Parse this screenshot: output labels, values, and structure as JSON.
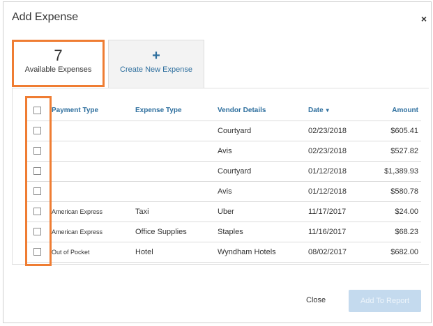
{
  "dialog": {
    "title": "Add Expense",
    "close_glyph": "×"
  },
  "tabs": {
    "available": {
      "count": "7",
      "label": "Available Expenses"
    },
    "create": {
      "plus": "+",
      "label": "Create New Expense"
    }
  },
  "table": {
    "headers": {
      "payment_type": "Payment Type",
      "expense_type": "Expense Type",
      "vendor_details": "Vendor Details",
      "date": "Date",
      "date_sort_glyph": "▼",
      "amount": "Amount"
    },
    "rows": [
      {
        "payment_type": "",
        "expense_type": "",
        "vendor": "Courtyard",
        "date": "02/23/2018",
        "amount": "$605.41"
      },
      {
        "payment_type": "",
        "expense_type": "",
        "vendor": "Avis",
        "date": "02/23/2018",
        "amount": "$527.82"
      },
      {
        "payment_type": "",
        "expense_type": "",
        "vendor": "Courtyard",
        "date": "01/12/2018",
        "amount": "$1,389.93"
      },
      {
        "payment_type": "",
        "expense_type": "",
        "vendor": "Avis",
        "date": "01/12/2018",
        "amount": "$580.78"
      },
      {
        "payment_type": "American Express",
        "expense_type": "Taxi",
        "vendor": "Uber",
        "date": "11/17/2017",
        "amount": "$24.00"
      },
      {
        "payment_type": "American Express",
        "expense_type": "Office Supplies",
        "vendor": "Staples",
        "date": "11/16/2017",
        "amount": "$68.23"
      },
      {
        "payment_type": "Out of Pocket",
        "expense_type": "Hotel",
        "vendor": "Wyndham Hotels",
        "date": "08/02/2017",
        "amount": "$682.00"
      }
    ]
  },
  "footer": {
    "close_label": "Close",
    "add_label": "Add To Report"
  },
  "colors": {
    "highlight": "#ef7d33",
    "link": "#2e6f9e",
    "disabled_button": "#c4daee"
  }
}
